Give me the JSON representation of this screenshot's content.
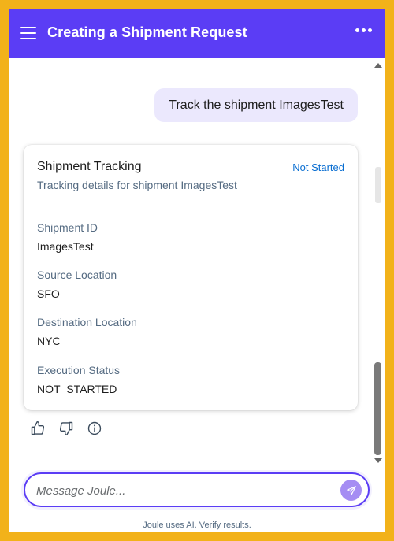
{
  "header": {
    "title": "Creating a Shipment Request",
    "background_color": "#5b3df5",
    "menu_icon": "hamburger-menu-icon",
    "more_icon": "more-options-icon"
  },
  "chat": {
    "user_message": "Track the shipment ImagesTest",
    "card": {
      "title": "Shipment Tracking",
      "status": "Not Started",
      "subtitle": "Tracking details for shipment ImagesTest",
      "fields": [
        {
          "label": "Shipment ID",
          "value": "ImagesTest"
        },
        {
          "label": "Source Location",
          "value": "SFO"
        },
        {
          "label": "Destination Location",
          "value": "NYC"
        },
        {
          "label": "Execution Status",
          "value": "NOT_STARTED"
        }
      ]
    },
    "feedback_icons": [
      "thumbs-up-icon",
      "thumbs-down-icon",
      "info-icon"
    ]
  },
  "composer": {
    "placeholder": "Message Joule...",
    "value": "",
    "send_icon": "send-icon"
  },
  "footer": {
    "disclaimer": "Joule uses AI. Verify results."
  },
  "colors": {
    "accent": "#5b3df5",
    "user_bubble": "#ebe8fd",
    "status_link": "#0a6ed1",
    "label": "#556b82",
    "outer_frame": "#f2b21a"
  }
}
